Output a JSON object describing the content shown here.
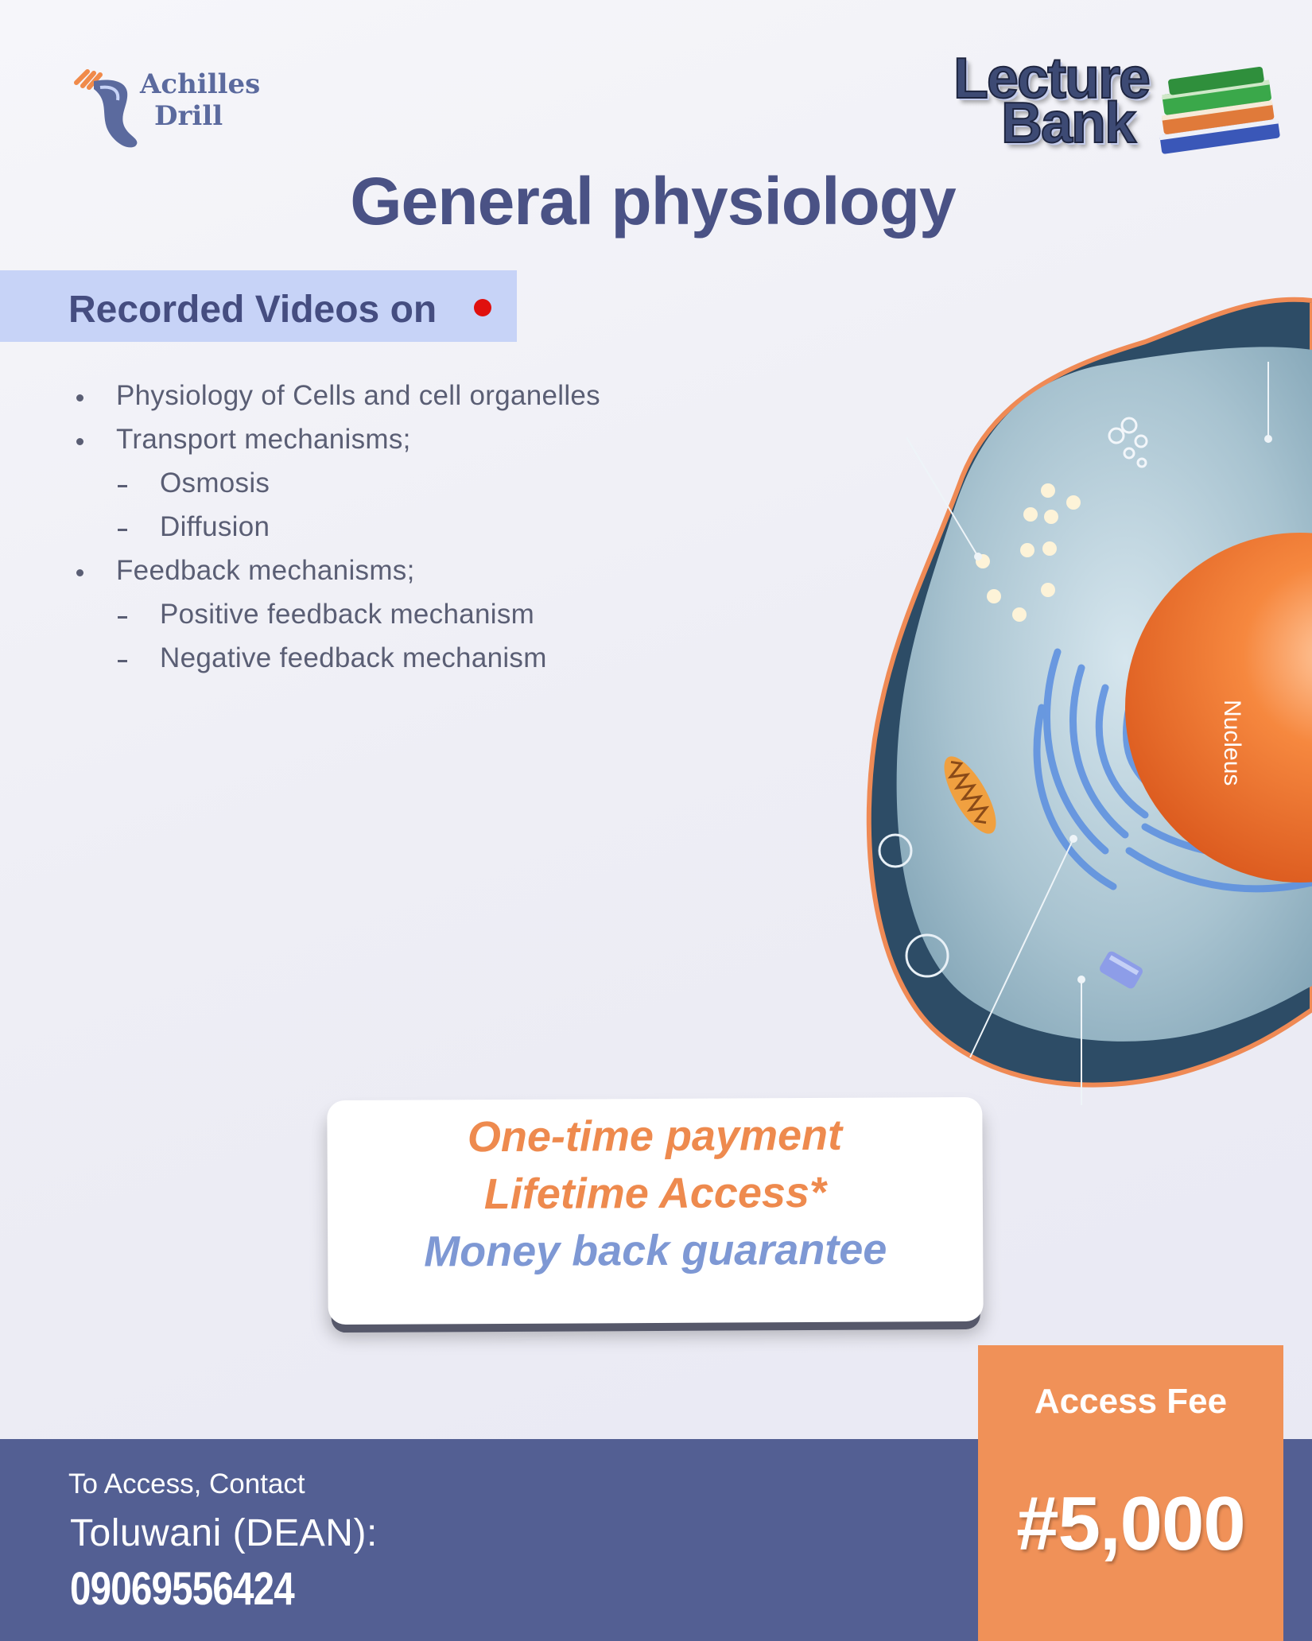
{
  "logos": {
    "achilles": {
      "line1": "Achilles",
      "line2": "Drill"
    },
    "lecture_bank": {
      "word1": "Lecture",
      "word2": "Bank"
    }
  },
  "title": "General physiology",
  "videos_banner": {
    "label": "Recorded Videos on",
    "indicator_color": "#e0100e"
  },
  "topics": [
    {
      "text": "Physiology of Cells and cell organelles",
      "marker": "bullet"
    },
    {
      "text": "Transport mechanisms;",
      "marker": "bullet"
    },
    {
      "text": "Osmosis",
      "marker": "dash"
    },
    {
      "text": "Diffusion",
      "marker": "dash"
    },
    {
      "text": "Feedback mechanisms;",
      "marker": "bullet"
    },
    {
      "text": "Positive feedback mechanism",
      "marker": "dash"
    },
    {
      "text": "Negative feedback mechanism",
      "marker": "dash"
    }
  ],
  "cell_illustration": {
    "nucleus_label": "Nucleus"
  },
  "offer": {
    "line1": "One-time payment",
    "line2": "Lifetime Access*",
    "line3": "Money back guarantee"
  },
  "contact": {
    "label": "To Access, Contact",
    "name": "Toluwani (DEAN):",
    "phone": "09069556424"
  },
  "fee": {
    "label": "Access Fee",
    "amount": "#5,000"
  },
  "colors": {
    "primary": "#535f93",
    "accent": "#f09158",
    "title": "#4a5285",
    "offer_orange": "#ee8a4e",
    "offer_blue": "#7e98d4"
  }
}
